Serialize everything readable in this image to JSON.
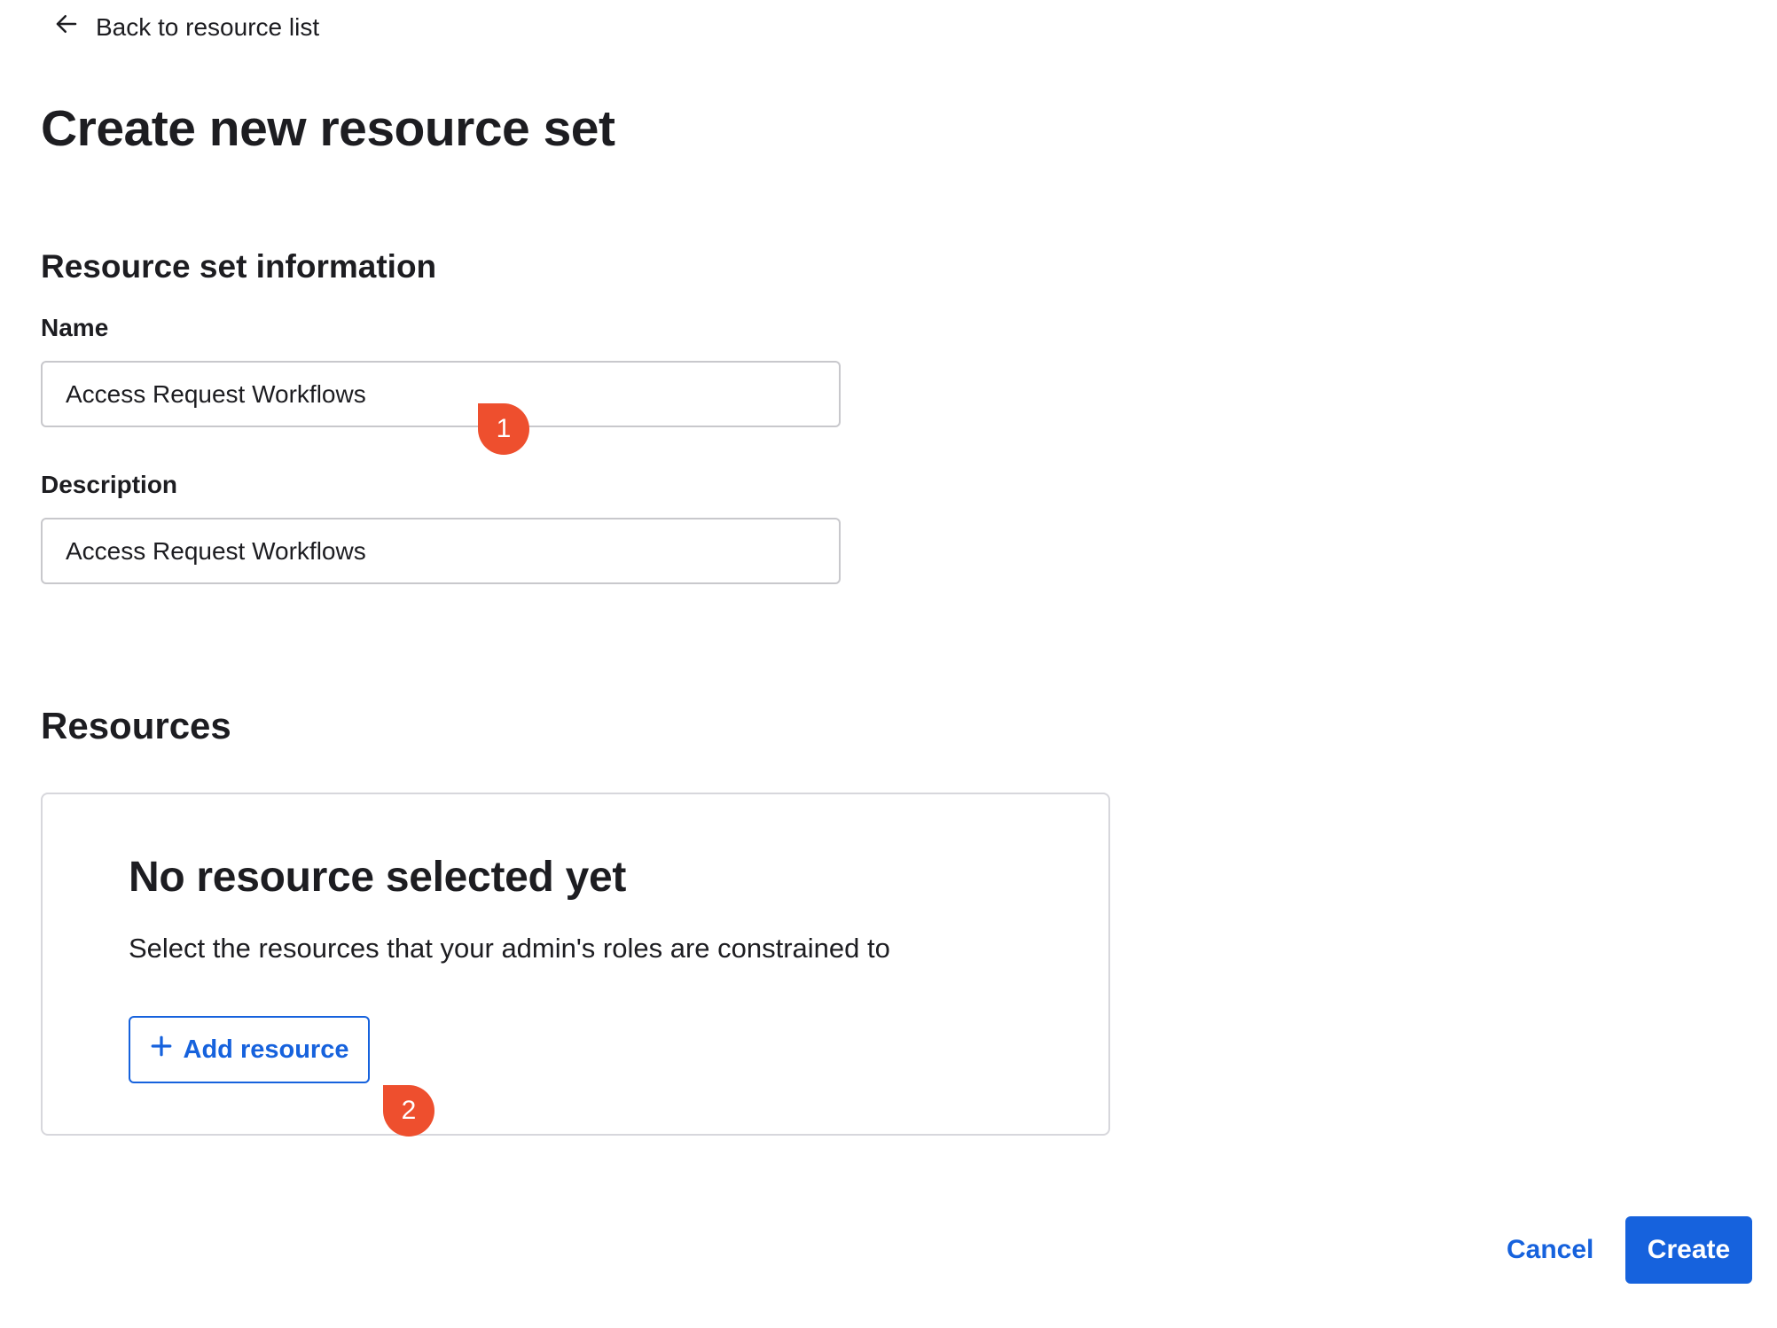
{
  "nav": {
    "back_label": "Back to resource list",
    "back_icon": "arrow-left-icon"
  },
  "page": {
    "title": "Create new resource set"
  },
  "resource_set_info": {
    "heading": "Resource set information",
    "name_label": "Name",
    "name_value": "Access Request Workflows",
    "description_label": "Description",
    "description_value": "Access Request Workflows"
  },
  "resources": {
    "heading": "Resources",
    "empty_title": "No resource selected yet",
    "empty_description": "Select the resources that your admin's roles are constrained to",
    "add_button_label": "Add resource",
    "add_button_icon": "plus-icon"
  },
  "markers": {
    "first": "1",
    "second": "2"
  },
  "footer": {
    "cancel_label": "Cancel",
    "create_label": "Create"
  },
  "colors": {
    "primary": "#1662dd",
    "marker": "#ee4f2e",
    "text": "#1d1d21",
    "border": "#c8c8cc"
  }
}
